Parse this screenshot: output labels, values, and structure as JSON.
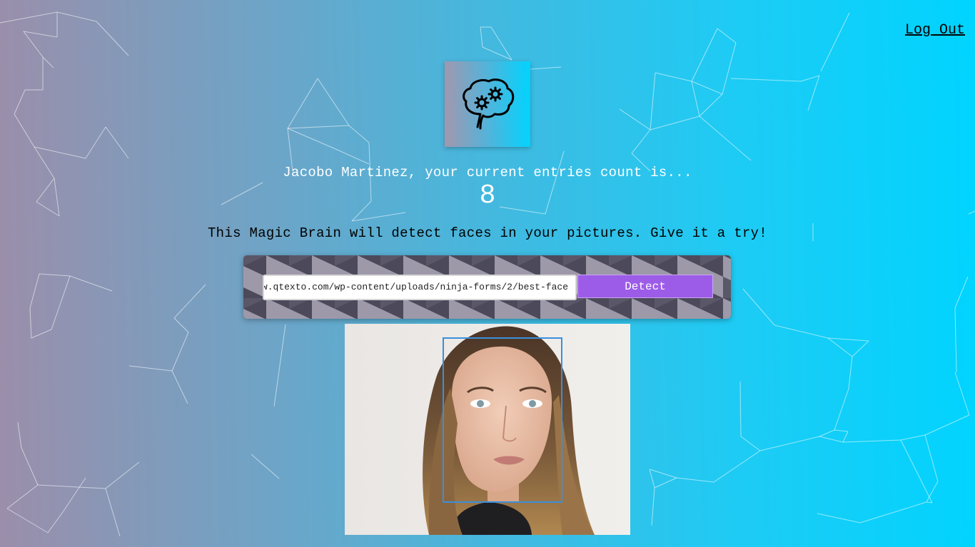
{
  "header": {
    "logout_label": "Log Out"
  },
  "logo": {
    "icon": "brain-gears-icon"
  },
  "rank": {
    "message": "Jacobo Martinez, your current entries count is...",
    "count": "8"
  },
  "intro_text": "This Magic Brain will detect faces in your pictures. Give it a try!",
  "image_form": {
    "input_value": "https://www.qtexto.com/wp-content/uploads/ninja-forms/2/best-face",
    "button_label": "Detect"
  },
  "result_image": {
    "description_icon": "portrait-photo",
    "face_boxes_detected": 1
  },
  "colors": {
    "gradient_start": "#9b8eaa",
    "gradient_end": "#00d4ff",
    "button": "#9d5ce8",
    "face_box": "#3a8fdc"
  }
}
